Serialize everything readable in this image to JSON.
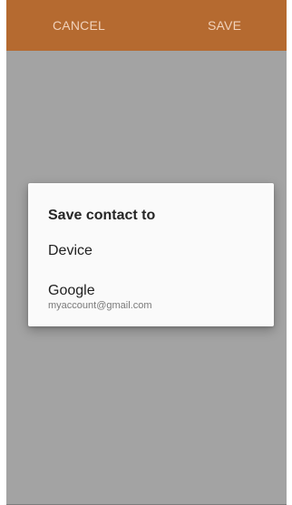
{
  "toolbar": {
    "cancel_label": "CANCEL",
    "save_label": "SAVE",
    "background_color": "#b56a30"
  },
  "dialog": {
    "title": "Save contact to",
    "options": [
      {
        "label": "Device"
      },
      {
        "label": "Google",
        "sublabel": "myaccount@gmail.com"
      }
    ]
  },
  "colors": {
    "scrim": "#a3a3a3",
    "dialog_background": "#fafafa"
  }
}
